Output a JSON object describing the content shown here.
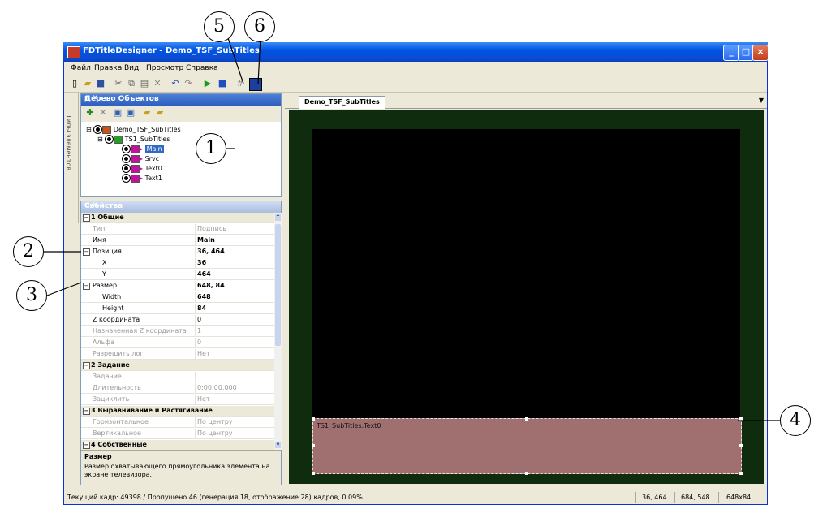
{
  "window": {
    "title": "FDTitleDesigner - Demo_TSF_SubTitles"
  },
  "menu": [
    "Файл",
    "Правка",
    "Вид",
    "Просмотр",
    "Справка"
  ],
  "toolbar_icons": [
    "new-icon",
    "open-icon",
    "save-icon",
    "cut-icon",
    "copy-icon",
    "paste-icon",
    "delete-icon",
    "undo-icon",
    "redo-icon",
    "play-icon",
    "stop-icon",
    "grid-icon",
    "fullscreen-icon"
  ],
  "dock_tab": "Типы элементов",
  "tree": {
    "title": "Дерево Объектов",
    "nodes": [
      {
        "label": "Demo_TSF_SubTitles",
        "level": 0
      },
      {
        "label": "TS1_SubTitles",
        "level": 1
      },
      {
        "label": "Main",
        "level": 2,
        "selected": true
      },
      {
        "label": "Srvc",
        "level": 2
      },
      {
        "label": "Text0",
        "level": 2
      },
      {
        "label": "Text1",
        "level": 2
      }
    ]
  },
  "properties": {
    "title": "Свойства",
    "rows": [
      {
        "name": "1 Общие",
        "value": "",
        "kind": "category"
      },
      {
        "name": "Тип",
        "value": "Подпись",
        "kind": "dim"
      },
      {
        "name": "Имя",
        "value": "Main",
        "kind": "bold"
      },
      {
        "name": "Позиция",
        "value": "36, 464",
        "kind": "bold",
        "expander": true
      },
      {
        "name": "X",
        "value": "36",
        "kind": "bold",
        "indent": true
      },
      {
        "name": "Y",
        "value": "464",
        "kind": "bold",
        "indent": true
      },
      {
        "name": "Размер",
        "value": "648, 84",
        "kind": "bold",
        "expander": true
      },
      {
        "name": "Width",
        "value": "648",
        "kind": "bold",
        "indent": true
      },
      {
        "name": "Height",
        "value": "84",
        "kind": "bold",
        "indent": true
      },
      {
        "name": "Z координата",
        "value": "0",
        "kind": "normal"
      },
      {
        "name": "Назначенная Z координата",
        "value": "1",
        "kind": "dim"
      },
      {
        "name": "Альфа",
        "value": "0",
        "kind": "dim"
      },
      {
        "name": "Разрешить лог",
        "value": "Нет",
        "kind": "dim"
      },
      {
        "name": "2 Задание",
        "value": "",
        "kind": "category"
      },
      {
        "name": "Задание",
        "value": "",
        "kind": "dim"
      },
      {
        "name": "Длительность",
        "value": "0:00:00.000",
        "kind": "dim"
      },
      {
        "name": "Зациклить",
        "value": "Нет",
        "kind": "dim"
      },
      {
        "name": "3 Выравнивание и Растягивание",
        "value": "",
        "kind": "category"
      },
      {
        "name": "Горизонтальное",
        "value": "По центру",
        "kind": "dim"
      },
      {
        "name": "Вертикальное",
        "value": "По центру",
        "kind": "dim"
      },
      {
        "name": "4 Собственные",
        "value": "",
        "kind": "category"
      }
    ],
    "desc_title": "Размер",
    "desc_text": "Размер охватывающего прямоугольника элемента на экране телевизора."
  },
  "document": {
    "tab": "Demo_TSF_SubTitles",
    "element_label": "TS1_SubTitles.Text0"
  },
  "status": {
    "main": "Текущий кадр: 49398 / Пропущено 46 (генерация 18, отображение 28) кадров,  0,09%",
    "pos": "36, 464",
    "end": "684, 548",
    "size": "648x84"
  },
  "callouts": [
    "1",
    "2",
    "3",
    "4",
    "5",
    "6"
  ]
}
